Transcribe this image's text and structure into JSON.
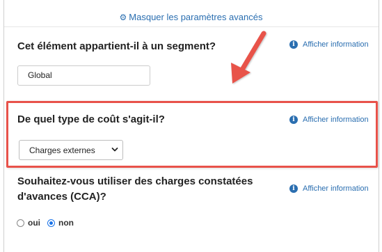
{
  "advanced_toggle": {
    "label": "Masquer les paramètres avancés",
    "icon": "gear-icon"
  },
  "sections": [
    {
      "question": "Cet élément appartient-il à un segment?",
      "info_label": "Afficher information",
      "input_value": "Global"
    },
    {
      "question": "De quel type de coût s'agit-il?",
      "info_label": "Afficher information",
      "select_value": "Charges externes"
    },
    {
      "question_line1": "Souhaitez-vous utiliser des charges constatées",
      "question_line2": "d'avances (CCA)?",
      "info_label": "Afficher information",
      "options": [
        {
          "label": "oui",
          "selected": false
        },
        {
          "label": "non",
          "selected": true
        }
      ]
    }
  ],
  "colors": {
    "link": "#2a6eb0",
    "highlight": "#e8524a",
    "radio_selected": "#1a73e8"
  }
}
